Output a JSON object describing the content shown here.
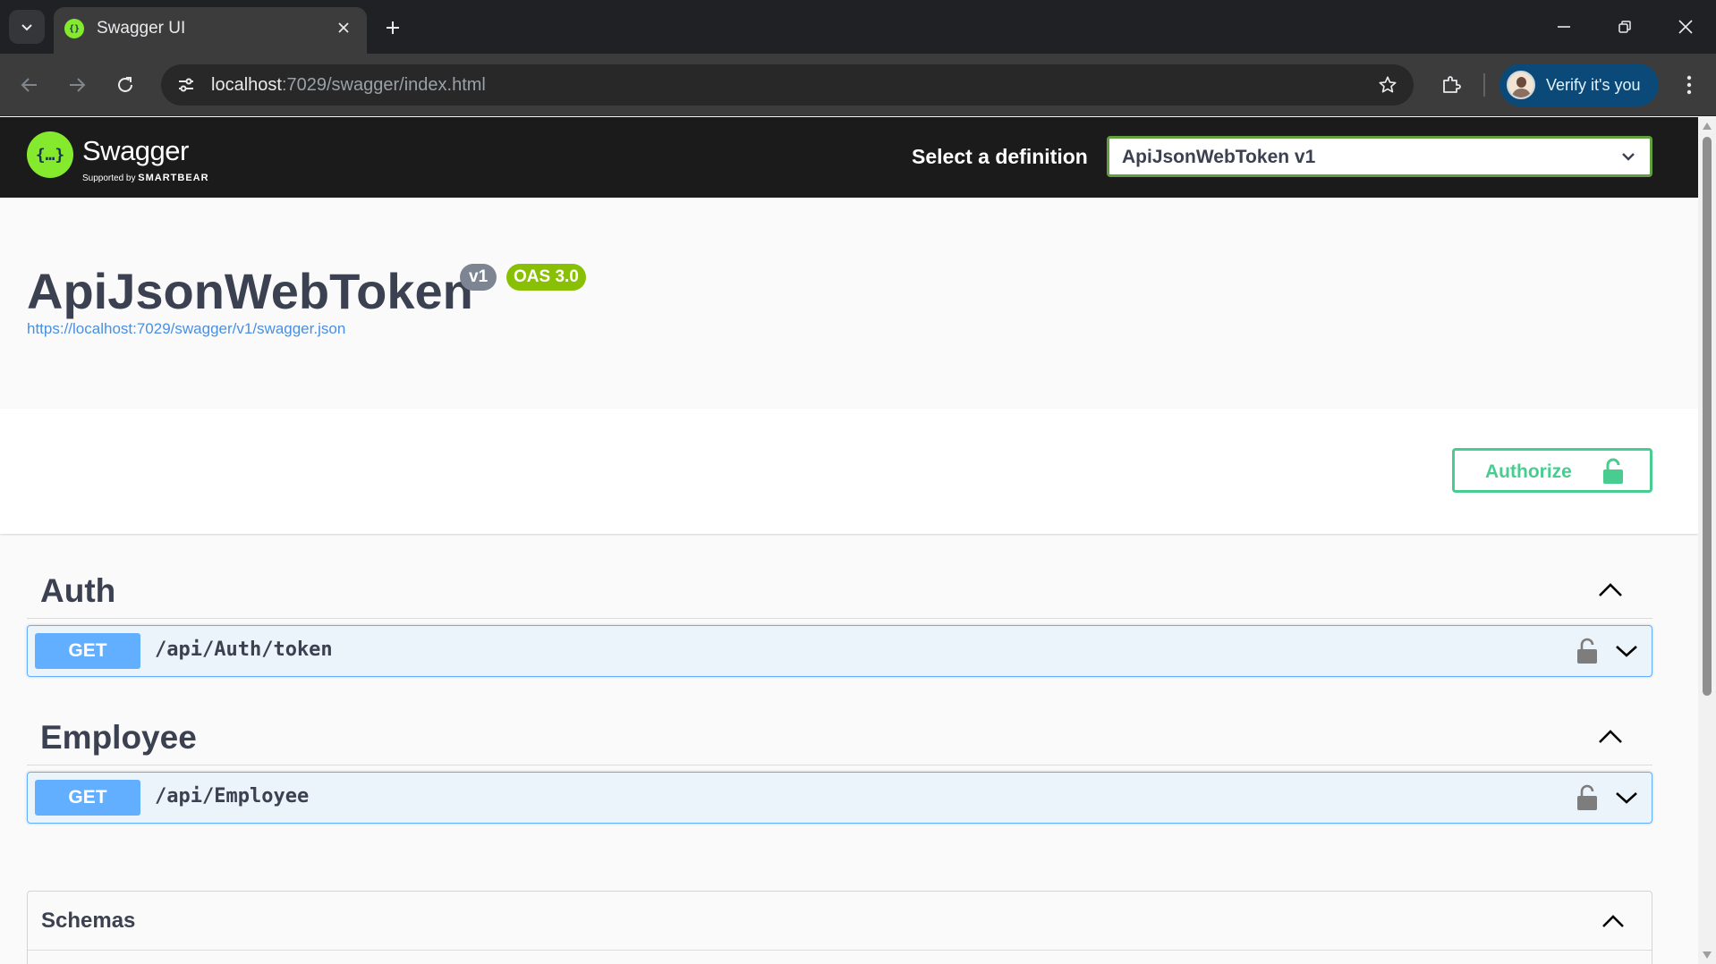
{
  "browser": {
    "tab_title": "Swagger UI",
    "url_host": "localhost",
    "url_rest": ":7029/swagger/index.html",
    "profile_label": "Verify it's you",
    "icons": [
      "tab-search-icon",
      "close-icon",
      "plus-icon",
      "minimize-icon",
      "restore-icon",
      "back-icon",
      "forward-icon",
      "reload-icon",
      "site-info-icon",
      "star-icon",
      "extensions-icon",
      "more-vert-icon"
    ]
  },
  "swagger": {
    "brand": "Swagger",
    "supported_by": "Supported by",
    "smartbear": "SMARTBEAR",
    "logo_glyph": "{…}",
    "definition_label": "Select a definition",
    "definition_value": "ApiJsonWebToken v1",
    "title": "ApiJsonWebToken",
    "version_badge": "v1",
    "oas_badge": "OAS 3.0",
    "spec_url": "https://localhost:7029/swagger/v1/swagger.json",
    "authorize_label": "Authorize",
    "tags": [
      {
        "name": "Auth",
        "operations": [
          {
            "method": "GET",
            "path": "/api/Auth/token"
          }
        ]
      },
      {
        "name": "Employee",
        "operations": [
          {
            "method": "GET",
            "path": "/api/Employee"
          }
        ]
      }
    ],
    "schemas_title": "Schemas"
  },
  "colors": {
    "get_method": "#61affe",
    "authorize": "#49cc90",
    "swagger_green": "#85ea2d",
    "select_border": "#62a03f",
    "oas_badge": "#89bf04"
  }
}
